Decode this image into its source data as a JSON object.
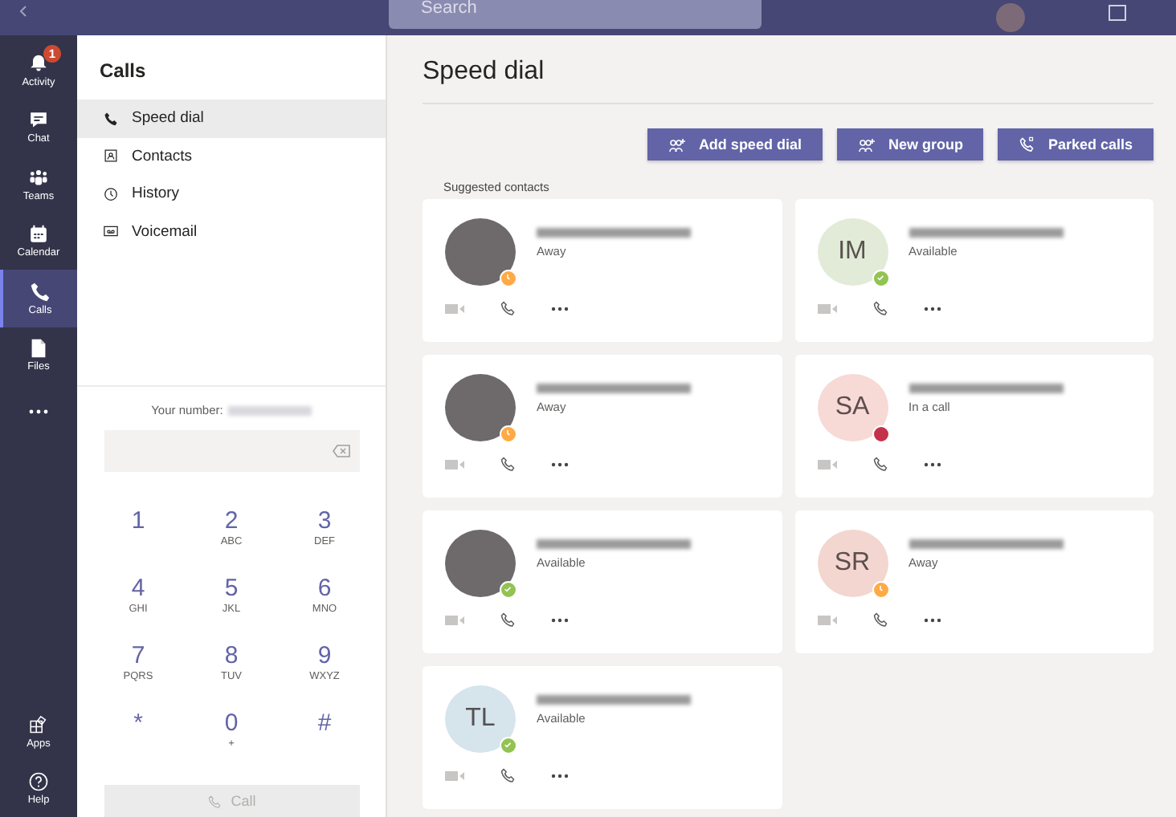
{
  "top_bar": {
    "search_placeholder": "Search"
  },
  "rail": {
    "items": [
      {
        "label": "Activity",
        "badge": "1",
        "selected": false
      },
      {
        "label": "Chat",
        "selected": false
      },
      {
        "label": "Teams",
        "selected": false
      },
      {
        "label": "Calendar",
        "selected": false
      },
      {
        "label": "Calls",
        "selected": true
      },
      {
        "label": "Files",
        "selected": false
      },
      {
        "selected": false
      }
    ],
    "bottom_items": [
      {
        "label": "Apps"
      },
      {
        "label": "Help"
      }
    ]
  },
  "calls_panel": {
    "title": "Calls",
    "nav": [
      {
        "label": "Speed dial",
        "selected": true
      },
      {
        "label": "Contacts",
        "selected": false
      },
      {
        "label": "History",
        "selected": false
      },
      {
        "label": "Voicemail",
        "selected": false
      }
    ],
    "number_label": "Your number:",
    "dialpad": [
      {
        "digit": "1"
      },
      {
        "digit": "2",
        "letters": "ABC"
      },
      {
        "digit": "3",
        "letters": "DEF"
      },
      {
        "digit": "4",
        "letters": "GHI"
      },
      {
        "digit": "5",
        "letters": "JKL"
      },
      {
        "digit": "6",
        "letters": "MNO"
      },
      {
        "digit": "7",
        "letters": "PQRS"
      },
      {
        "digit": "8",
        "letters": "TUV"
      },
      {
        "digit": "9",
        "letters": "WXYZ"
      },
      {
        "digit": "*"
      },
      {
        "digit": "0",
        "letters": "+"
      },
      {
        "digit": "#"
      }
    ],
    "call_button": {
      "label": "Call",
      "disabled": true
    }
  },
  "main": {
    "title": "Speed dial",
    "buttons": [
      {
        "label": "Add speed dial"
      },
      {
        "label": "New group"
      },
      {
        "label": "Parked calls"
      }
    ],
    "section_label": "Suggested contacts",
    "contacts": [
      {
        "kind": "photo",
        "presence": {
          "kind": "away",
          "text": "Away"
        }
      },
      {
        "kind": "initials",
        "initials": "IM",
        "color": "#e2ebd8",
        "presence": {
          "kind": "available",
          "text": "Available"
        }
      },
      {
        "kind": "photo",
        "presence": {
          "kind": "away",
          "text": "Away"
        }
      },
      {
        "kind": "initials",
        "initials": "SA",
        "color": "#f7d9d6",
        "presence": {
          "kind": "busy",
          "text": "In a call"
        }
      },
      {
        "kind": "photo",
        "presence": {
          "kind": "available",
          "text": "Available"
        }
      },
      {
        "kind": "initials",
        "initials": "SR",
        "color": "#f3d6cf",
        "presence": {
          "kind": "away",
          "text": "Away"
        }
      },
      {
        "kind": "initials",
        "initials": "TL",
        "color": "#d6e4ec",
        "presence": {
          "kind": "available",
          "text": "Available"
        }
      }
    ]
  }
}
